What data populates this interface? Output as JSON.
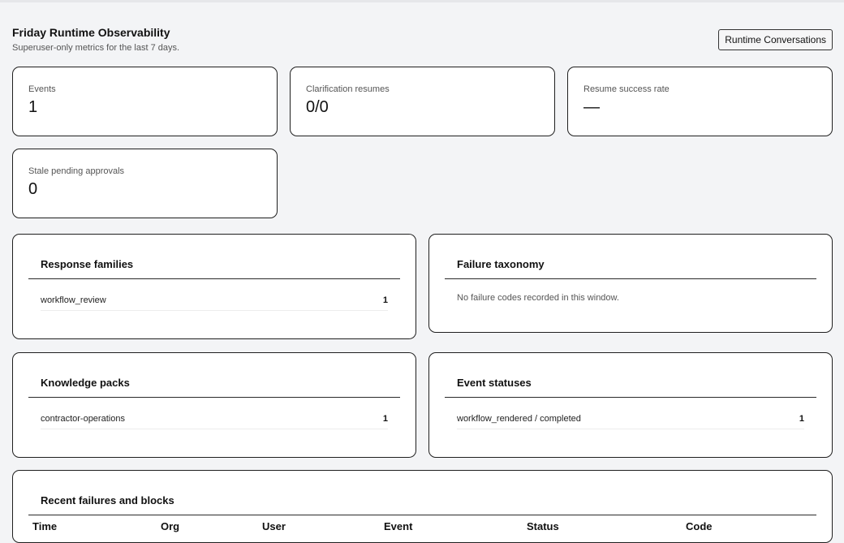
{
  "header": {
    "title": "Friday Runtime Observability",
    "subtitle": "Superuser-only metrics for the last 7 days.",
    "conversations_button": "Runtime Conversations"
  },
  "metrics": [
    {
      "label": "Events",
      "value": "1"
    },
    {
      "label": "Clarification resumes",
      "value": "0/0"
    },
    {
      "label": "Resume success rate",
      "value": "—"
    },
    {
      "label": "Stale pending approvals",
      "value": "0"
    }
  ],
  "response_families": {
    "title": "Response families",
    "rows": [
      {
        "label": "workflow_review",
        "count": "1"
      }
    ]
  },
  "failure_taxonomy": {
    "title": "Failure taxonomy",
    "empty_message": "No failure codes recorded in this window."
  },
  "knowledge_packs": {
    "title": "Knowledge packs",
    "rows": [
      {
        "label": "contractor-operations",
        "count": "1"
      }
    ]
  },
  "event_statuses": {
    "title": "Event statuses",
    "rows": [
      {
        "label": "workflow_rendered / completed",
        "count": "1"
      }
    ]
  },
  "recent_failures": {
    "title": "Recent failures and blocks",
    "columns": [
      "Time",
      "Org",
      "User",
      "Event",
      "Status",
      "Code"
    ]
  }
}
